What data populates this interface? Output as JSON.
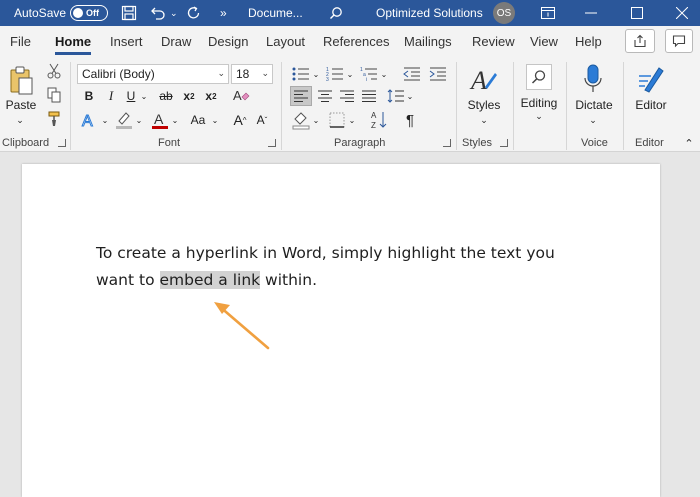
{
  "titlebar": {
    "autosave_label": "AutoSave",
    "autosave_state": "Off",
    "more": "»",
    "doc_title": "Docume...",
    "user_name": "Optimized Solutions",
    "user_initials": "OS"
  },
  "menu": {
    "tabs": [
      "File",
      "Home",
      "Insert",
      "Draw",
      "Design",
      "Layout",
      "References",
      "Mailings",
      "Review",
      "View",
      "Help"
    ],
    "active_tab": "Home"
  },
  "ribbon": {
    "clipboard": {
      "paste_label": "Paste",
      "group_label": "Clipboard"
    },
    "font": {
      "font_name": "Calibri (Body)",
      "font_size": "18",
      "bold": "B",
      "italic": "I",
      "underline": "U",
      "strike": "ab",
      "subscript": "x",
      "sub_mark": "2",
      "superscript": "x",
      "sup_mark": "2",
      "change_case": "Aa",
      "grow": "A",
      "shrink": "A",
      "group_label": "Font"
    },
    "paragraph": {
      "group_label": "Paragraph",
      "sort": "A Z",
      "pilcrow": "¶"
    },
    "styles": {
      "label": "Styles",
      "group_label": "Styles"
    },
    "editing": {
      "label": "Editing"
    },
    "voice": {
      "label": "Dictate",
      "group_label": "Voice"
    },
    "editor": {
      "label": "Editor",
      "group_label": "Editor"
    }
  },
  "document": {
    "text_before": "To create a hyperlink in Word, simply highlight the text you want to ",
    "highlighted": "embed a link",
    "text_after": " within."
  },
  "colors": {
    "title_bar": "#2b579a",
    "highlight": "#d2d2d2",
    "arrow": "#f0a040",
    "font_color_bar": "#c00000"
  }
}
